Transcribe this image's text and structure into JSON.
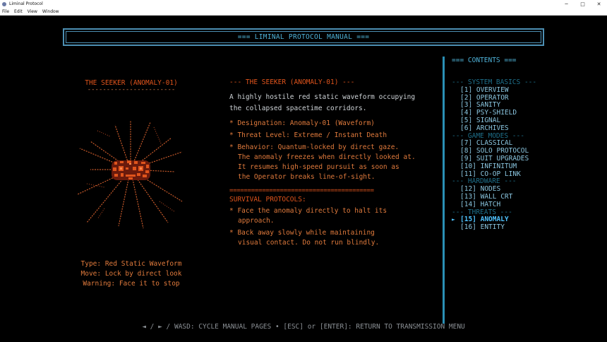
{
  "window": {
    "title": "Liminal Protocol",
    "controls": {
      "minimize": "─",
      "maximize": "□",
      "close": "✕"
    }
  },
  "menubar": {
    "items": [
      "File",
      "Edit",
      "View",
      "Window"
    ]
  },
  "header": {
    "title": "=== LIMINAL PROTOCOL MANUAL ==="
  },
  "left": {
    "title": "THE SEEKER (ANOMALY-01)",
    "underline": "-----------------------",
    "stats": [
      "Type: Red Static Waveform",
      "Move: Lock by direct look",
      "Warning: Face it to stop"
    ]
  },
  "main": {
    "heading": "--- THE SEEKER (ANOMALY-01) ---",
    "description": [
      "A highly hostile red static waveform occupying",
      "the collapsed spacetime corridors."
    ],
    "bullets": [
      [
        "* Designation: Anomaly-01 (Waveform)"
      ],
      [
        "* Threat Level: Extreme / Instant Death"
      ],
      [
        "* Behavior: Quantum-locked by direct gaze.",
        "The anomaly freezes when directly looked at.",
        "It resumes high-speed pursuit as soon as",
        "the Operator breaks line-of-sight."
      ]
    ],
    "divider": "========================================",
    "survival_heading": "SURVIVAL PROTOCOLS:",
    "survival": [
      [
        "* Face the anomaly directly to halt its",
        "approach."
      ],
      [
        "* Back away slowly while maintaining",
        "visual contact. Do not run blindly."
      ]
    ]
  },
  "contents": {
    "title": "=== CONTENTS ===",
    "entries": [
      {
        "kind": "cat",
        "text": "--- SYSTEM BASICS ---"
      },
      {
        "kind": "item",
        "text": "[1] OVERVIEW"
      },
      {
        "kind": "item",
        "text": "[2] OPERATOR"
      },
      {
        "kind": "item",
        "text": "[3] SANITY"
      },
      {
        "kind": "item",
        "text": "[4] PSY-SHIELD"
      },
      {
        "kind": "item",
        "text": "[5] SIGNAL"
      },
      {
        "kind": "item",
        "text": "[6] ARCHIVES"
      },
      {
        "kind": "cat",
        "text": "--- GAME MODES ---"
      },
      {
        "kind": "item",
        "text": "[7] CLASSICAL"
      },
      {
        "kind": "item",
        "text": "[8] SOLO PROTOCOL"
      },
      {
        "kind": "item",
        "text": "[9] SUIT UPGRADES"
      },
      {
        "kind": "item",
        "text": "[10] INFINITUM"
      },
      {
        "kind": "item",
        "text": "[11] CO-OP LINK"
      },
      {
        "kind": "cat",
        "text": "--- HARDWARE ---"
      },
      {
        "kind": "item",
        "text": "[12] NODES"
      },
      {
        "kind": "item",
        "text": "[13] WALL CRT"
      },
      {
        "kind": "item",
        "text": "[14] HATCH"
      },
      {
        "kind": "cat",
        "text": "--- THREATS ---"
      },
      {
        "kind": "item",
        "text": "[15] ANOMALY",
        "active": true,
        "marker": "►"
      },
      {
        "kind": "item",
        "text": "[16] ENTITY"
      }
    ]
  },
  "footer": {
    "hint": "◄ / ► / WASD: CYCLE MANUAL PAGES  •  [ESC] or [ENTER]: RETURN TO TRANSMISSION MENU"
  },
  "colors": {
    "accent_cyan": "#4fb3d9",
    "anomaly_red": "#e0541c",
    "bullet_orange": "#e07a3c",
    "category_dim": "#1e6f8a"
  }
}
